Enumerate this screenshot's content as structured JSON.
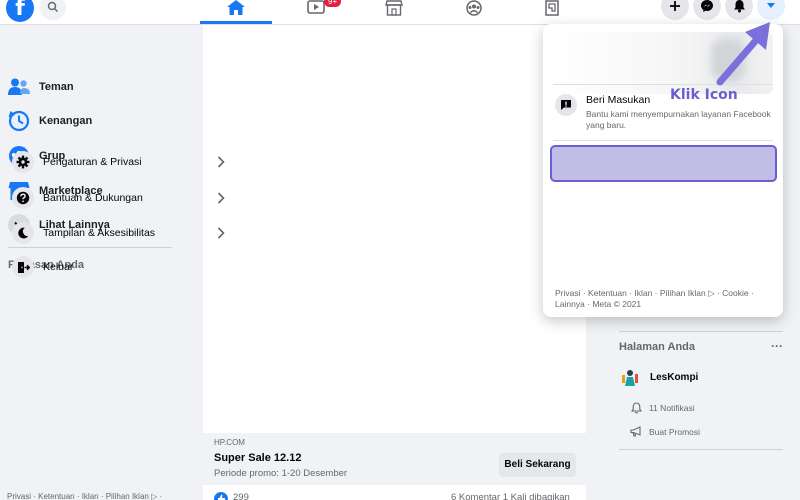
{
  "topbar": {
    "logo": "f",
    "icons": [
      "facebook-logo",
      "search-icon",
      "home-icon",
      "watch-icon",
      "marketplace-icon",
      "groups-icon",
      "gaming-icon",
      "plus-icon",
      "messenger-icon",
      "bell-icon",
      "caret-down-icon"
    ],
    "video_badge": "9+"
  },
  "sidebar": {
    "items": [
      {
        "label": "Teman",
        "icon": "friends-icon"
      },
      {
        "label": "Kenangan",
        "icon": "memories-icon"
      },
      {
        "label": "Grup",
        "icon": "groups-icon"
      },
      {
        "label": "Marketplace",
        "icon": "marketplace-icon"
      },
      {
        "label": "Lihat Lainnya",
        "icon": "chevron-down-icon"
      }
    ],
    "shortcuts_title": "Pintasan Anda",
    "footer": "Privasi · Ketentuan · Iklan · Pilihan Iklan ▷ ·"
  },
  "feed": {
    "ad": {
      "domain": "HP.COM",
      "title": "Super Sale 12.12",
      "subtitle": "Periode promo: 1-20 Desember",
      "cta": "Beli Sekarang"
    },
    "reactions_count": "299",
    "comments_shares": "6 Komentar  1 Kali dibagikan"
  },
  "menu": {
    "feedback": {
      "label": "Beri Masukan",
      "desc": "Bantu kami menyempurnakan layanan Facebook yang baru."
    },
    "items": [
      {
        "label": "Pengaturan & Privasi",
        "icon": "gear-icon",
        "highlighted": true
      },
      {
        "label": "Bantuan & Dukungan",
        "icon": "help-icon"
      },
      {
        "label": "Tampilan & Aksesibilitas",
        "icon": "moon-icon"
      },
      {
        "label": "Keluar",
        "icon": "logout-icon"
      }
    ],
    "footer": "Privasi · Ketentuan · Iklan · Pilihan Iklan ▷ · Cookie · Lainnya · Meta © 2021"
  },
  "right": {
    "pages_title": "Halaman Anda",
    "more": "···",
    "page": {
      "name": "LesKompi",
      "notifications": "11 Notifikasi",
      "promo": "Buat Promosi"
    }
  },
  "annotation": {
    "text": "Klik Icon",
    "color": "#6a5ed0"
  },
  "colors": {
    "brand": "#1877f2",
    "badge": "#e41e3f",
    "highlight_fill": "#c2bde6",
    "highlight_border": "#6a5ed0"
  }
}
